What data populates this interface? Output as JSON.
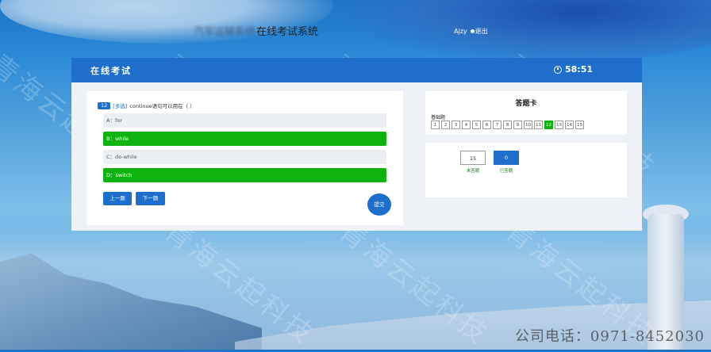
{
  "header": {
    "site_blurred": "汽车运输系统",
    "site_title": "在线考试系统",
    "user_label": "Ajzy",
    "logout_label": "退出"
  },
  "exam": {
    "title": "在线考试",
    "timer": "58:51"
  },
  "question": {
    "number": "12",
    "type": "[多选]",
    "text": "continue语句可以用在（ ）",
    "options": [
      {
        "label": "A：for",
        "selected": false
      },
      {
        "label": "B：while",
        "selected": true
      },
      {
        "label": "C：do-while",
        "selected": false
      },
      {
        "label": "D：switch",
        "selected": true
      }
    ],
    "prev_label": "上一题",
    "next_label": "下一题",
    "submit_label": "提交"
  },
  "answer_card": {
    "title": "答题卡",
    "section": "基础题",
    "cells": [
      "1",
      "2",
      "3",
      "4",
      "5",
      "6",
      "7",
      "8",
      "9",
      "10",
      "11",
      "12",
      "13",
      "14",
      "15"
    ],
    "answered_index": 11
  },
  "legend": {
    "unanswered_count": "15",
    "unanswered_label": "未答题",
    "answered_count": "0",
    "answered_label": "已答题"
  },
  "footer": {
    "phone": "公司电话：0971-8452030"
  },
  "watermark": "青海云起科技",
  "colors": {
    "primary": "#1e6fcb",
    "selected": "#0fb30f"
  }
}
